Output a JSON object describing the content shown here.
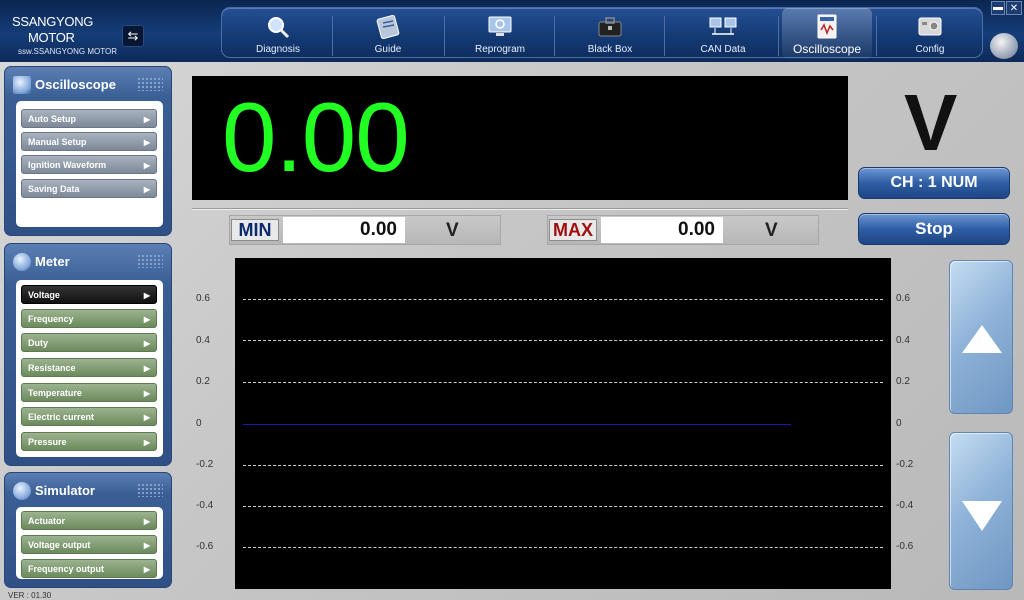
{
  "brand": {
    "line1": "SSANGYONG",
    "line2": "MOTOR",
    "tagline": "ssw.SSANGYONG MOTOR"
  },
  "nav": [
    {
      "label": "Diagnosis",
      "icon": "magnifier-icon",
      "active": false
    },
    {
      "label": "Guide",
      "icon": "book-icon",
      "active": false
    },
    {
      "label": "Reprogram",
      "icon": "monitor-icon",
      "active": false
    },
    {
      "label": "Black Box",
      "icon": "briefcase-icon",
      "active": false
    },
    {
      "label": "CAN Data",
      "icon": "network-icon",
      "active": false
    },
    {
      "label": "Oscilloscope",
      "icon": "oscilloscope-icon",
      "active": true
    },
    {
      "label": "Config",
      "icon": "config-icon",
      "active": false
    }
  ],
  "panels": {
    "oscilloscope": {
      "title": "Oscilloscope",
      "items": [
        "Auto Setup",
        "Manual Setup",
        "Ignition Waveform",
        "Saving Data"
      ]
    },
    "meter": {
      "title": "Meter",
      "items": [
        "Voltage",
        "Frequency",
        "Duty",
        "Resistance",
        "Temperature",
        "Electric current",
        "Pressure"
      ],
      "selected": "Voltage"
    },
    "simulator": {
      "title": "Simulator",
      "items": [
        "Actuator",
        "Voltage output",
        "Frequency output"
      ]
    }
  },
  "display": {
    "value": "0.00",
    "unit": "V",
    "channel_button": "CH : 1 NUM",
    "stop_button": "Stop",
    "min_label": "MIN",
    "min_value": "0.00",
    "min_unit": "V",
    "max_label": "MAX",
    "max_value": "0.00",
    "max_unit": "V"
  },
  "plot": {
    "y_ticks": [
      "0.6",
      "0.4",
      "0.2",
      "0",
      "-0.2",
      "-0.4",
      "-0.6"
    ]
  },
  "version": "VER : 01.30",
  "colors": {
    "value_green": "#22ff22",
    "min_label": "#0d2a6e",
    "max_label": "#a01010",
    "trace": "#1b1bb0"
  }
}
